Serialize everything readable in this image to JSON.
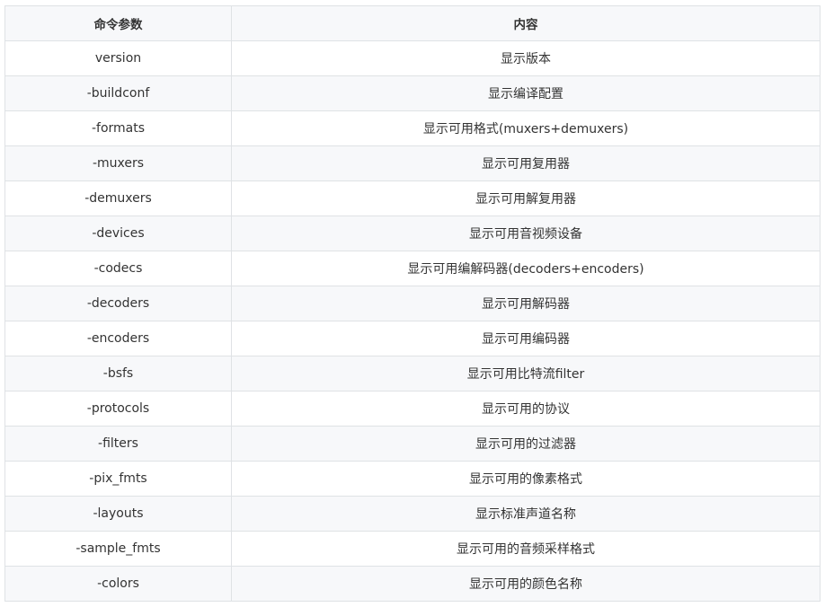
{
  "table": {
    "headers": [
      "命令参数",
      "内容"
    ],
    "rows": [
      [
        "version",
        "显示版本"
      ],
      [
        "-buildconf",
        "显示编译配置"
      ],
      [
        "-formats",
        "显示可用格式(muxers+demuxers)"
      ],
      [
        "-muxers",
        "显示可用复用器"
      ],
      [
        "-demuxers",
        "显示可用解复用器"
      ],
      [
        "-devices",
        "显示可用音视频设备"
      ],
      [
        "-codecs",
        "显示可用编解码器(decoders+encoders)"
      ],
      [
        "-decoders",
        "显示可用解码器"
      ],
      [
        "-encoders",
        "显示可用编码器"
      ],
      [
        "-bsfs",
        "显示可用比特流filter"
      ],
      [
        "-protocols",
        "显示可用的协议"
      ],
      [
        "-filters",
        "显示可用的过滤器"
      ],
      [
        "-pix_fmts",
        "显示可用的像素格式"
      ],
      [
        "-layouts",
        "显示标准声道名称"
      ],
      [
        "-sample_fmts",
        "显示可用的音频采样格式"
      ],
      [
        "-colors",
        "显示可用的颜色名称"
      ]
    ]
  }
}
